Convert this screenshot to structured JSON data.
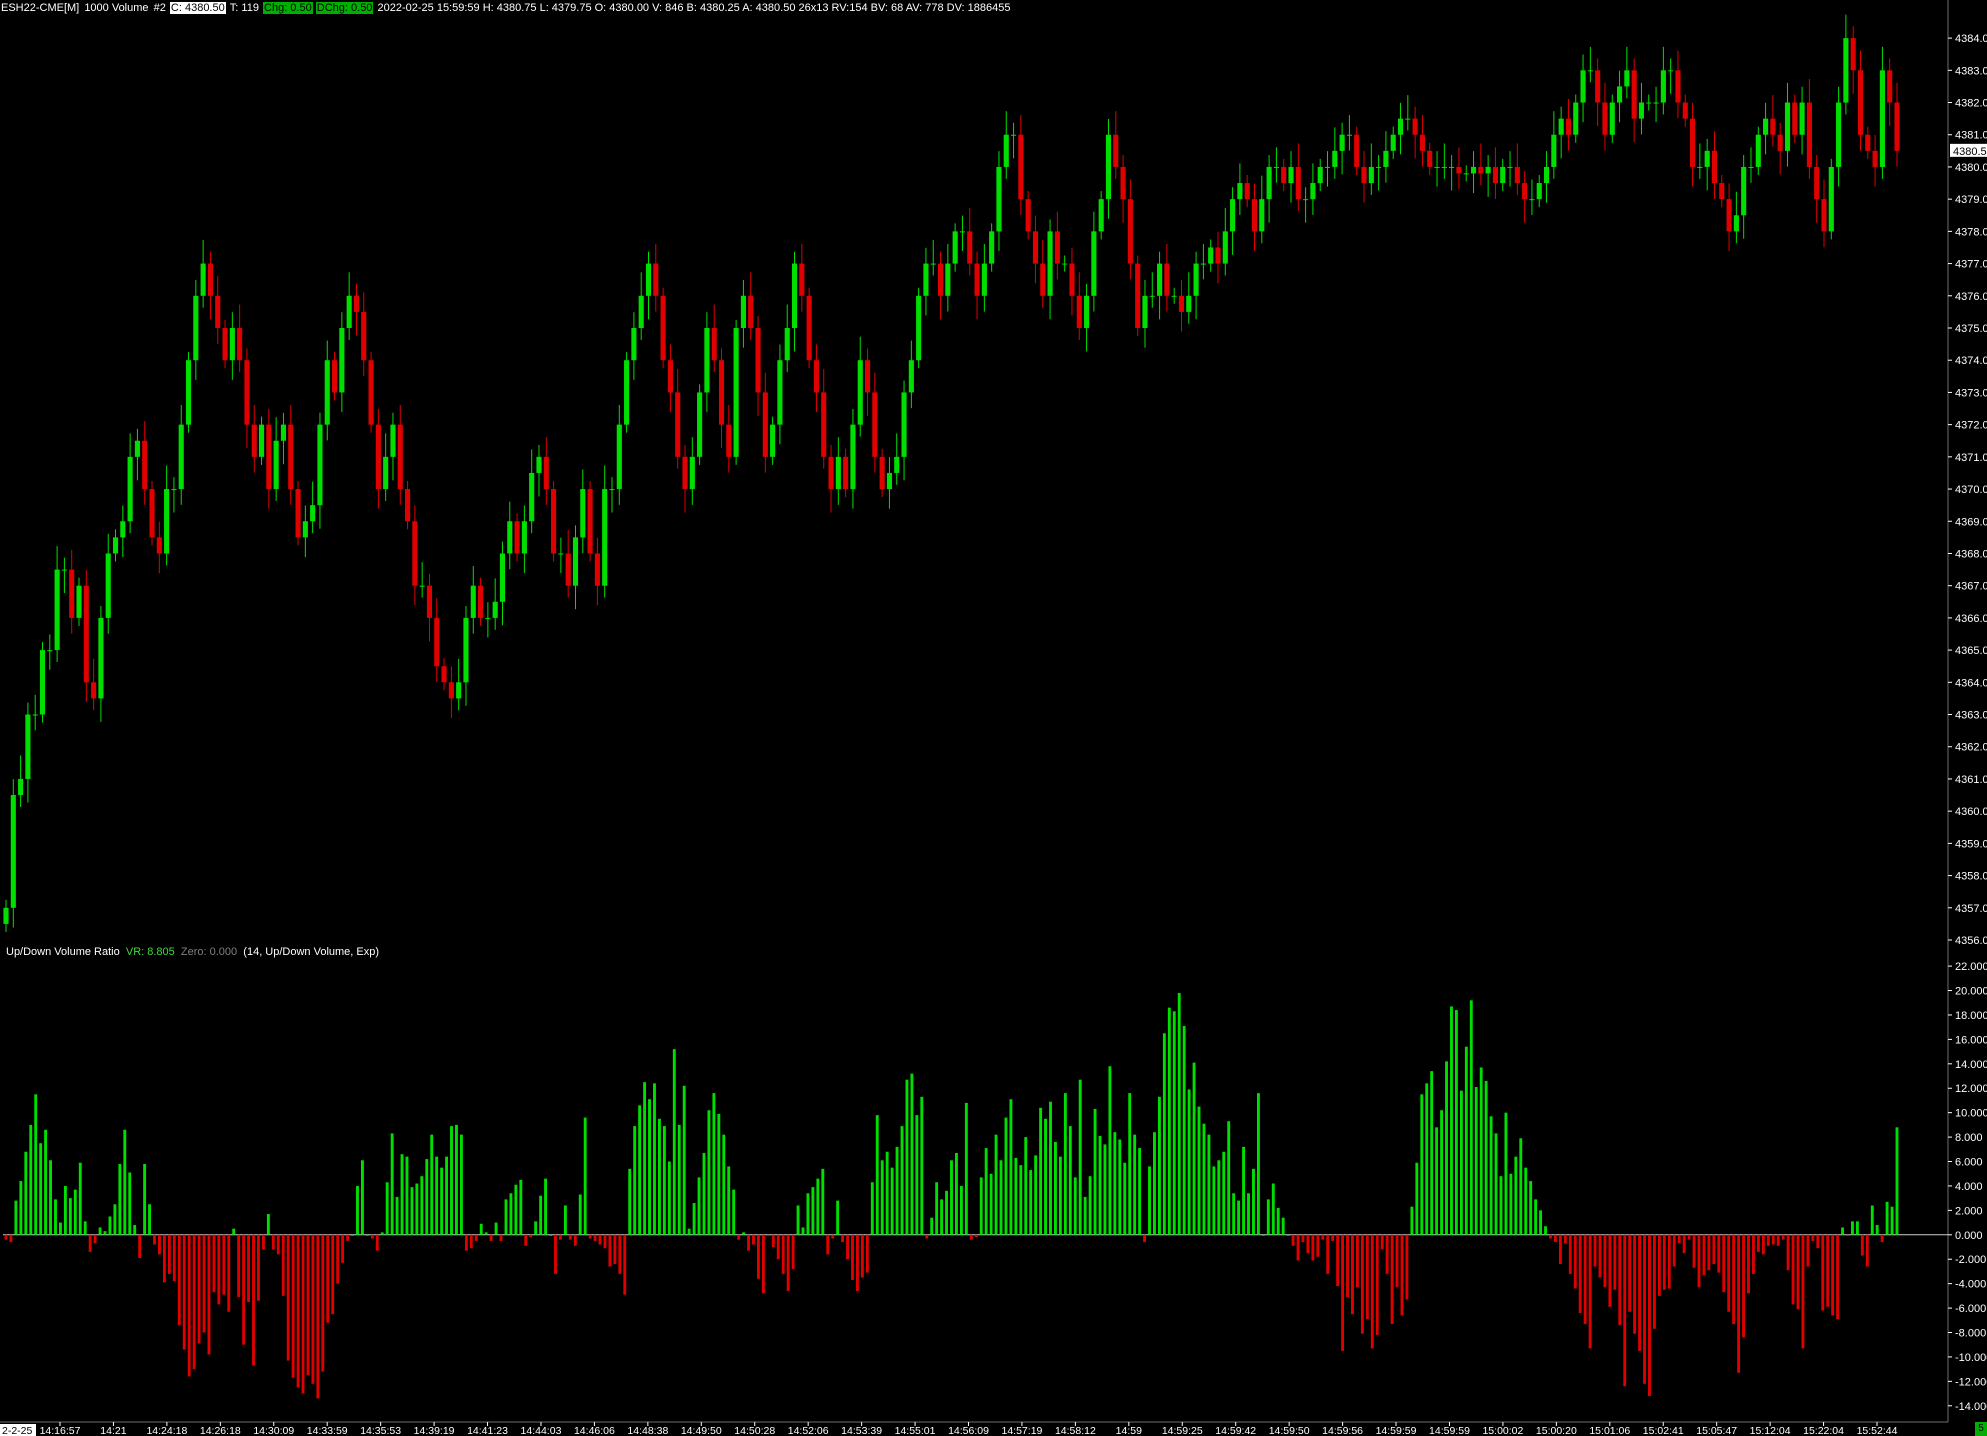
{
  "header": {
    "symbol": "ESH22-CME[M]",
    "bar_type": "1000 Volume",
    "chart_num": "#2",
    "close": "C: 4380.50",
    "trades": "T: 119",
    "chg": "Chg: 0.50",
    "dchg": "DChg: 0.50",
    "info": "2022-02-25 15:59:59 H: 4380.75 L: 4379.75 O: 4380.00 V: 846 B: 4380.25 A: 4380.50 26x13 RV:154 BV: 68 AV: 778 DV: 1886455"
  },
  "subchart": {
    "name": "Up/Down Volume Ratio",
    "vr": "VR: 8.805",
    "zero": "Zero: 0.000",
    "params": "(14, Up/Down Volume, Exp)"
  },
  "badge": "5",
  "colors": {
    "up": "#00e000",
    "down": "#e00000",
    "axis": "#ffffff",
    "background": "#000000"
  },
  "chart_data": [
    {
      "type": "candlestick",
      "ylim": [
        4356,
        4384.5
      ],
      "y_ticks": [
        "4356.00",
        "4357.00",
        "4358.00",
        "4359.00",
        "4360.00",
        "4361.00",
        "4362.00",
        "4363.00",
        "4364.00",
        "4365.00",
        "4366.00",
        "4367.00",
        "4368.00",
        "4369.00",
        "4370.00",
        "4371.00",
        "4372.00",
        "4373.00",
        "4374.00",
        "4375.00",
        "4376.00",
        "4377.00",
        "4378.00",
        "4379.00",
        "4380.00",
        "4381.00",
        "4382.00",
        "4383.00",
        "4384.00"
      ],
      "last_price_label": "4380.50",
      "last_price": 4380.5,
      "close": [
        4357,
        4360.5,
        4361,
        4363,
        4363,
        4365,
        4365,
        4367.5,
        4367.5,
        4366,
        4367,
        4364,
        4363.5,
        4366,
        4368,
        4368.5,
        4369,
        4371,
        4371.5,
        4370,
        4368.5,
        4368,
        4370,
        4370,
        4372,
        4374,
        4376,
        4377,
        4376,
        4375,
        4374,
        4375,
        4374,
        4372,
        4371,
        4372,
        4370,
        4371.5,
        4372,
        4370,
        4368.5,
        4369,
        4369.5,
        4372,
        4374,
        4373,
        4375,
        4376,
        4375.5,
        4374,
        4372,
        4370,
        4371,
        4372,
        4370,
        4369,
        4367,
        4367,
        4366,
        4364.5,
        4364,
        4363.5,
        4364,
        4366,
        4367,
        4366,
        4366,
        4366.5,
        4368,
        4369,
        4368,
        4369,
        4370.5,
        4371,
        4370,
        4368,
        4368,
        4367,
        4368.5,
        4370,
        4368,
        4367,
        4370,
        4370,
        4372,
        4374,
        4375,
        4376,
        4377,
        4376,
        4374,
        4373,
        4371,
        4370,
        4371,
        4373,
        4375,
        4374,
        4372,
        4371,
        4375,
        4376,
        4375,
        4373,
        4371,
        4372,
        4374,
        4375,
        4377,
        4376,
        4374,
        4373,
        4371,
        4370,
        4371,
        4370,
        4372,
        4374,
        4373,
        4371,
        4370,
        4370.5,
        4371,
        4373,
        4374,
        4376,
        4377,
        4377,
        4376,
        4377,
        4378,
        4378,
        4377,
        4376,
        4377,
        4378,
        4380,
        4381,
        4381,
        4379,
        4378,
        4377,
        4376,
        4378,
        4377,
        4377,
        4376,
        4375,
        4376,
        4378,
        4379,
        4381,
        4380,
        4379,
        4377,
        4375,
        4376,
        4376,
        4377,
        4376,
        4376,
        4375.5,
        4376,
        4377,
        4377,
        4377.5,
        4377,
        4378,
        4379,
        4379.5,
        4379,
        4378,
        4379,
        4380,
        4380,
        4379.5,
        4380,
        4379,
        4379,
        4379.5,
        4380,
        4380,
        4380.5,
        4381,
        4381,
        4380,
        4379.5,
        4380,
        4380,
        4380.5,
        4381,
        4381.5,
        4381.5,
        4381,
        4380.5,
        4380,
        4380,
        4380,
        4380,
        4379.8,
        4379.8,
        4380,
        4379.8,
        4380,
        4379.5,
        4380,
        4380,
        4379.5,
        4379,
        4379,
        4379.5,
        4380,
        4381,
        4381.5,
        4381,
        4382,
        4383,
        4383,
        4382,
        4381,
        4382,
        4382.5,
        4383,
        4381.5,
        4382,
        4382,
        4382,
        4383,
        4383,
        4382,
        4381.5,
        4380,
        4380,
        4380.5,
        4379.5,
        4379,
        4378,
        4378.5,
        4380,
        4380,
        4381,
        4381.5,
        4381,
        4380.5,
        4382,
        4381,
        4382,
        4380,
        4379,
        4378,
        4380,
        4382,
        4384,
        4383,
        4381,
        4380.5,
        4380,
        4383,
        4382,
        4380.5
      ]
    },
    {
      "type": "bar",
      "ylim": [
        -15,
        22.5
      ],
      "y_ticks": [
        "22.000",
        "20.000",
        "18.000",
        "16.000",
        "14.000",
        "12.000",
        "10.000",
        "8.000",
        "6.000",
        "4.000",
        "2.000",
        "0.000",
        "-2.000",
        "-4.000",
        "-6.000",
        "-8.000",
        "-10.000",
        "-12.000",
        "-14.000"
      ],
      "values": [
        -0.4,
        -0.6,
        2.8,
        4.4,
        6.8,
        9,
        11.5,
        7.5,
        8.6,
        6.1,
        2.9,
        1,
        4,
        3,
        3.7,
        5.9,
        1.1,
        -1.4,
        -0.7,
        0.6,
        0.3,
        1.5,
        2.5,
        5.8,
        8.6,
        5.1,
        0.8,
        -1.9,
        5.8,
        2.5,
        -0.8,
        -1.6,
        -3.9,
        -3.2,
        -3.8,
        -7.4,
        -9.4,
        -11.6,
        -11,
        -8.9,
        -8,
        -9.8,
        -4.7,
        -5.7,
        -4.9,
        -6.3,
        0.5,
        -5.1,
        -9,
        -5.5,
        -10.7,
        -5.4,
        -1.2,
        1.7,
        -1.2,
        -1.6,
        -5,
        -10.3,
        -11.7,
        -12.5,
        -13,
        -11.5,
        -12.2,
        -13.4,
        -11.2,
        -7.2,
        -6.5,
        -4,
        -2.3,
        -0.5,
        0,
        4,
        6.1,
        0,
        -0.3,
        -1.3,
        0.2,
        4.3,
        8.3,
        3.1,
        6.6,
        6.4,
        3.9,
        4.2,
        4.8,
        6.2,
        8.2,
        6.4,
        5.5,
        6.4,
        8.9,
        9,
        8.2,
        -1.3,
        -1.1,
        -0.5,
        0.9,
        0.2,
        -0.5,
        1,
        -0.5,
        2.9,
        3.4,
        4.1,
        4.5,
        -0.9,
        -0.2,
        1.1,
        3.2,
        4.6,
        0,
        -3.2,
        -0.4,
        2.4,
        -0.4,
        -0.9,
        3.3,
        9.6,
        -0.3,
        -0.5,
        -0.8,
        -1.1,
        -2.6,
        -2.4,
        -3.2,
        -4.9,
        5.4,
        8.9,
        10.6,
        12.5,
        11.1,
        12.4,
        9.5,
        8.9,
        6,
        15.2,
        9,
        12.2,
        0.5,
        2.6,
        4.7,
        6.7,
        10.2,
        11.6,
        9.9,
        8.2,
        5.6,
        3.7,
        -0.4,
        0.2,
        -1.3,
        -0.8,
        -3.6,
        -4.8,
        -0.1,
        -1,
        -2,
        -3.2,
        -4.6,
        -2.8,
        2.4,
        0.6,
        3.4,
        3.9,
        4.6,
        5.4,
        -1.6,
        -0.3,
        2.8,
        -0.6,
        -2,
        -3.7,
        -4.6,
        -3.5,
        -3.1,
        4.3,
        9.8,
        6.1,
        6.8,
        5.5,
        7.2,
        8.9,
        12.7,
        13.2,
        9.8,
        11.3,
        -0.3,
        1.4,
        4.3,
        2.9,
        3.6,
        6.1,
        6.7,
        4,
        10.8,
        -0.4,
        -0.2,
        4.7,
        7.1,
        5,
        8.2,
        6.1,
        9.6,
        11.1,
        6.3,
        5.7,
        8,
        5.3,
        6.5,
        10.4,
        9.5,
        10.9,
        7.6,
        6.4,
        11.6,
        8.9,
        4.7,
        12.7,
        3.1,
        4.8,
        10.3,
        8.1,
        7.4,
        13.8,
        8.4,
        7.8,
        5.9,
        11.6,
        8.2,
        7.1,
        -0.6,
        5.6,
        8.4,
        11.3,
        16.5,
        18.6,
        18.3,
        19.8,
        17.1,
        11.9,
        14.1,
        10.5,
        9.1,
        8.2,
        5.6,
        6.1,
        6.8,
        9.3,
        3.4,
        2.8,
        7.2,
        3.4,
        5.4,
        11.6,
        0,
        2.9,
        4.2,
        2.2,
        1.4,
        0,
        -0.9,
        -2.1,
        -0.6,
        -1.5,
        -2.1,
        -1.8,
        -0.4,
        -3.2,
        -0.5,
        -4.2,
        -9.5,
        -5.1,
        -6.5,
        -4.3,
        -8.1,
        -6.9,
        -9.3,
        -8.2,
        -1.2,
        -3.2,
        -7.3,
        -4.3,
        -6.6,
        -5.3,
        2.3,
        5.9,
        11.5,
        12.4,
        13.4,
        8.8,
        10.2,
        14.2,
        18.7,
        18.4,
        11.8,
        15.4,
        19.2,
        12.1,
        13.7,
        12.6,
        9.7,
        8.3,
        4.8,
        10,
        5,
        6.4,
        7.9,
        5.5,
        4.4,
        2.9,
        2,
        0.7,
        -0.3,
        -0.6,
        -2.4,
        -0.7,
        -3.2,
        -4.4,
        -6.4,
        -7.3,
        -9.3,
        -2.6,
        -3.5,
        -4.3,
        -5.9,
        -4.5,
        -7.4,
        -12.4,
        -6.3,
        -8.1,
        -9.5,
        -12.2,
        -13.2,
        -7.7,
        -5,
        -4.5,
        -4.4,
        -2.6,
        -0.7,
        -1.5,
        -0.4,
        -2.7,
        -4.3,
        -3.3,
        -2.9,
        -2.4,
        -3.1,
        -4.7,
        -6.3,
        -7.3,
        -11.3,
        -8.4,
        -4.8,
        -3.2,
        -1.4,
        -1.6,
        -0.9,
        -0.8,
        -0.9,
        -0.4,
        -2.9,
        -5.7,
        -6.1,
        -9.3,
        -2.6,
        -0.5,
        -1.1,
        -6.2,
        -5.9,
        -6.6,
        -6.9,
        0.6,
        -0.1,
        1.1,
        1.1,
        -1.7,
        -2.6,
        2.4,
        0.8,
        -0.6,
        2.7,
        2.3,
        8.8
      ]
    }
  ],
  "x_axis": {
    "first_label": "2-2-25",
    "labels": [
      "14:16:57",
      "14:21",
      "14:24:18",
      "14:26:18",
      "14:30:09",
      "14:33:59",
      "14:35:53",
      "14:39:19",
      "14:41:23",
      "14:44:03",
      "14:46:06",
      "14:48:38",
      "14:49:50",
      "14:50:28",
      "14:52:06",
      "14:53:39",
      "14:55:01",
      "14:56:09",
      "14:57:19",
      "14:58:12",
      "14:59",
      "14:59:25",
      "14:59:42",
      "14:59:50",
      "14:59:56",
      "14:59:59",
      "14:59:59",
      "15:00:02",
      "15:00:20",
      "15:01:06",
      "15:02:41",
      "15:05:47",
      "15:12:04",
      "15:22:04",
      "15:52:44"
    ]
  }
}
